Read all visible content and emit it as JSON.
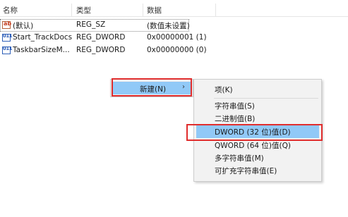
{
  "columns": {
    "name": "名称",
    "type": "类型",
    "data": "数据"
  },
  "rows": [
    {
      "name": "(默认)",
      "type": "REG_SZ",
      "data": "(数值未设置)",
      "icon": "string-value-icon"
    },
    {
      "name": "Start_TrackDocs",
      "type": "REG_DWORD",
      "data": "0x00000001 (1)",
      "icon": "binary-value-icon"
    },
    {
      "name": "TaskbarSizeM...",
      "type": "REG_DWORD",
      "data": "0x00000000 (0)",
      "icon": "binary-value-icon"
    }
  ],
  "icon_glyphs": {
    "string": "ab",
    "binary": "011"
  },
  "context_menu": {
    "new_label": "新建(N)",
    "arrow": "›"
  },
  "submenu": {
    "items": [
      "项(K)",
      "字符串值(S)",
      "二进制值(B)",
      "DWORD (32 位)值(D)",
      "QWORD (64 位)值(Q)",
      "多字符串值(M)",
      "可扩充字符串值(E)"
    ],
    "highlighted_index": 3
  },
  "colors": {
    "highlight": "#91c9f7",
    "annotation_red": "#e02d2d",
    "menu_bg": "#f2f2f2"
  }
}
